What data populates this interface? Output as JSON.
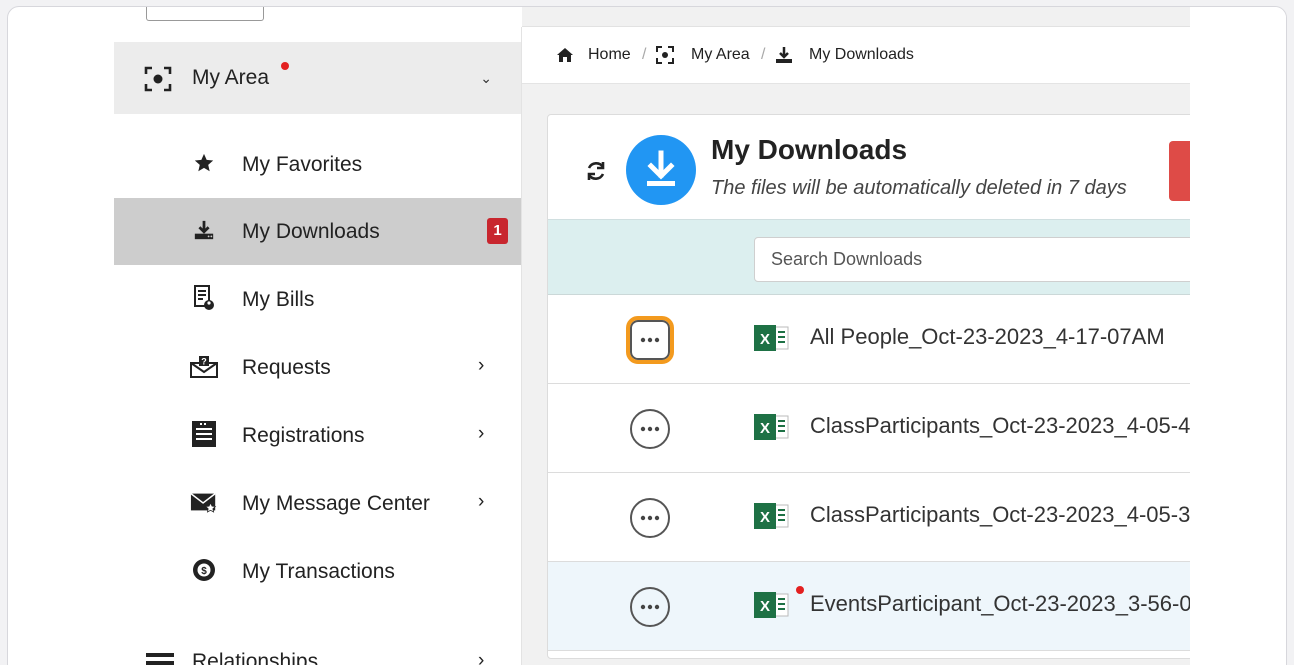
{
  "sidebar": {
    "my_area": {
      "label": "My Area",
      "has_notification_dot": true
    },
    "items": [
      {
        "label": "My Favorites",
        "icon": "star-icon",
        "has_chevron": false
      },
      {
        "label": "My Downloads",
        "icon": "download-tray-icon",
        "has_chevron": false,
        "badge": "1",
        "active": true
      },
      {
        "label": "My Bills",
        "icon": "bill-icon",
        "has_chevron": false
      },
      {
        "label": "Requests",
        "icon": "mail-question-icon",
        "has_chevron": true
      },
      {
        "label": "Registrations",
        "icon": "list-document-icon",
        "has_chevron": true
      },
      {
        "label": "My Message Center",
        "icon": "envelope-star-icon",
        "has_chevron": true
      },
      {
        "label": "My Transactions",
        "icon": "dollar-cycle-icon",
        "has_chevron": false
      }
    ],
    "relationships": {
      "label": "Relationships"
    }
  },
  "breadcrumb": {
    "home": "Home",
    "my_area": "My Area",
    "my_downloads": "My Downloads"
  },
  "downloads": {
    "title": "My Downloads",
    "subtitle": "The files will be automatically deleted in 7 days",
    "search_placeholder": "Search Downloads",
    "files": [
      {
        "name": "All People_Oct-23-2023_4-17-07AM",
        "focused": true,
        "new": false
      },
      {
        "name": "ClassParticipants_Oct-23-2023_4-05-4",
        "focused": false,
        "new": false
      },
      {
        "name": "ClassParticipants_Oct-23-2023_4-05-3",
        "focused": false,
        "new": false
      },
      {
        "name": "EventsParticipant_Oct-23-2023_3-56-0",
        "focused": false,
        "new": true
      }
    ]
  },
  "colors": {
    "accent_blue": "#2196f3",
    "badge_red": "#c8262e",
    "focus_orange": "#f39a1e",
    "search_band": "#dcefef",
    "excel_green": "#1e7145"
  }
}
